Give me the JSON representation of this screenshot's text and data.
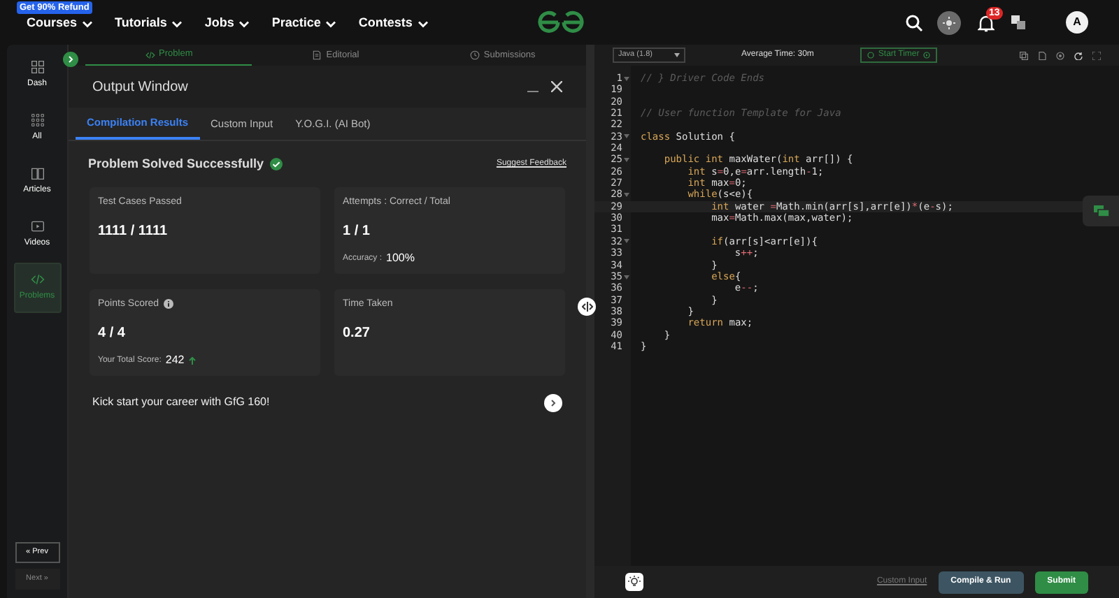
{
  "top_nav": {
    "promo_badge": "Get 90% Refund",
    "menus": [
      {
        "label": "Courses"
      },
      {
        "label": "Tutorials"
      },
      {
        "label": "Jobs"
      },
      {
        "label": "Practice"
      },
      {
        "label": "Contests"
      }
    ],
    "notification_count": "13",
    "avatar": "A"
  },
  "sidebar": {
    "items": [
      {
        "label": "Dash",
        "kind": "grid",
        "selected": false
      },
      {
        "label": "All",
        "kind": "dots",
        "selected": false
      },
      {
        "label": "Articles",
        "kind": "book",
        "selected": false
      },
      {
        "label": "Videos",
        "kind": "video",
        "selected": false
      },
      {
        "label": "Problems",
        "kind": "code",
        "selected": true
      }
    ],
    "prev": "« Prev",
    "next": "Next »"
  },
  "problem_tabs": [
    {
      "label": "Problem",
      "kind": "code",
      "selected": true
    },
    {
      "label": "Editorial",
      "kind": "doc",
      "selected": false
    },
    {
      "label": "Submissions",
      "kind": "clock",
      "selected": false
    }
  ],
  "output_window": {
    "title": "Output Window",
    "tabs": [
      {
        "label": "Compilation Results",
        "selected": true
      },
      {
        "label": "Custom Input",
        "selected": false
      },
      {
        "label": "Y.O.G.I. (AI Bot)",
        "selected": false
      }
    ],
    "status": "Problem Solved Successfully",
    "feedback_link": "Suggest Feedback",
    "cards": [
      {
        "label": "Test Cases Passed",
        "value": "1111 / 1111",
        "info": false
      },
      {
        "label": "Attempts : Correct / Total",
        "value": "1 / 1",
        "sub_label": "Accuracy :",
        "sub_value": "100%",
        "info": false
      },
      {
        "label": "Points Scored",
        "value": "4 / 4",
        "sub_label": "Your Total Score:",
        "sub_value": "242",
        "trend_up": true,
        "info": true
      },
      {
        "label": "Time Taken",
        "value": "0.27",
        "info": false
      }
    ],
    "promo": "Kick start your career with GfG 160!"
  },
  "editor": {
    "language": "Java (1.8)",
    "average_time": "Average Time: 30m",
    "timer_button": "Start Timer",
    "lines": [
      {
        "number": "1",
        "text": "// } Driver Code Ends",
        "kind": "comment",
        "foldable": true,
        "current": false
      },
      {
        "number": "19",
        "foldable": false,
        "current": false
      },
      {
        "number": "20",
        "foldable": false,
        "current": false
      },
      {
        "number": "21",
        "text": "// User function Template for Java",
        "kind": "comment",
        "foldable": false,
        "current": false
      },
      {
        "number": "22",
        "foldable": false,
        "current": false
      },
      {
        "number": "23",
        "text": "class Solution {",
        "kind": "code",
        "foldable": true,
        "current": false
      },
      {
        "number": "24",
        "foldable": false,
        "current": false
      },
      {
        "number": "25",
        "text": "    public int maxWater(int arr[]) {",
        "kind": "code",
        "foldable": true,
        "current": false
      },
      {
        "number": "26",
        "text": "        int s=0,e=arr.length-1;",
        "kind": "code",
        "foldable": false,
        "current": false
      },
      {
        "number": "27",
        "text": "        int max=0;",
        "kind": "code",
        "foldable": false,
        "current": false
      },
      {
        "number": "28",
        "text": "        while(s<e){",
        "kind": "code",
        "foldable": true,
        "current": false
      },
      {
        "number": "29",
        "text": "            int water =Math.min(arr[s],arr[e])*(e-s);",
        "kind": "code",
        "foldable": false,
        "current": true
      },
      {
        "number": "30",
        "text": "            max=Math.max(max,water);",
        "kind": "code",
        "foldable": false,
        "current": false
      },
      {
        "number": "31",
        "foldable": false,
        "current": false
      },
      {
        "number": "32",
        "text": "            if(arr[s]<arr[e]){",
        "kind": "code",
        "foldable": true,
        "current": false
      },
      {
        "number": "33",
        "text": "                s++;",
        "kind": "code",
        "foldable": false,
        "current": false
      },
      {
        "number": "34",
        "text": "            }",
        "kind": "code",
        "foldable": false,
        "current": false
      },
      {
        "number": "35",
        "text": "            else{",
        "kind": "code",
        "foldable": true,
        "current": false
      },
      {
        "number": "36",
        "text": "                e--;",
        "kind": "code",
        "foldable": false,
        "current": false
      },
      {
        "number": "37",
        "text": "            }",
        "kind": "code",
        "foldable": false,
        "current": false
      },
      {
        "number": "38",
        "text": "        }",
        "kind": "code",
        "foldable": false,
        "current": false
      },
      {
        "number": "39",
        "text": "        return max;",
        "kind": "code",
        "foldable": false,
        "current": false
      },
      {
        "number": "40",
        "text": "    }",
        "kind": "code",
        "foldable": false,
        "current": false
      },
      {
        "number": "41",
        "text": "}",
        "kind": "code",
        "foldable": false,
        "current": false
      }
    ],
    "custom_input": "Custom Input",
    "compile_button": "Compile & Run",
    "submit_button": "Submit"
  }
}
